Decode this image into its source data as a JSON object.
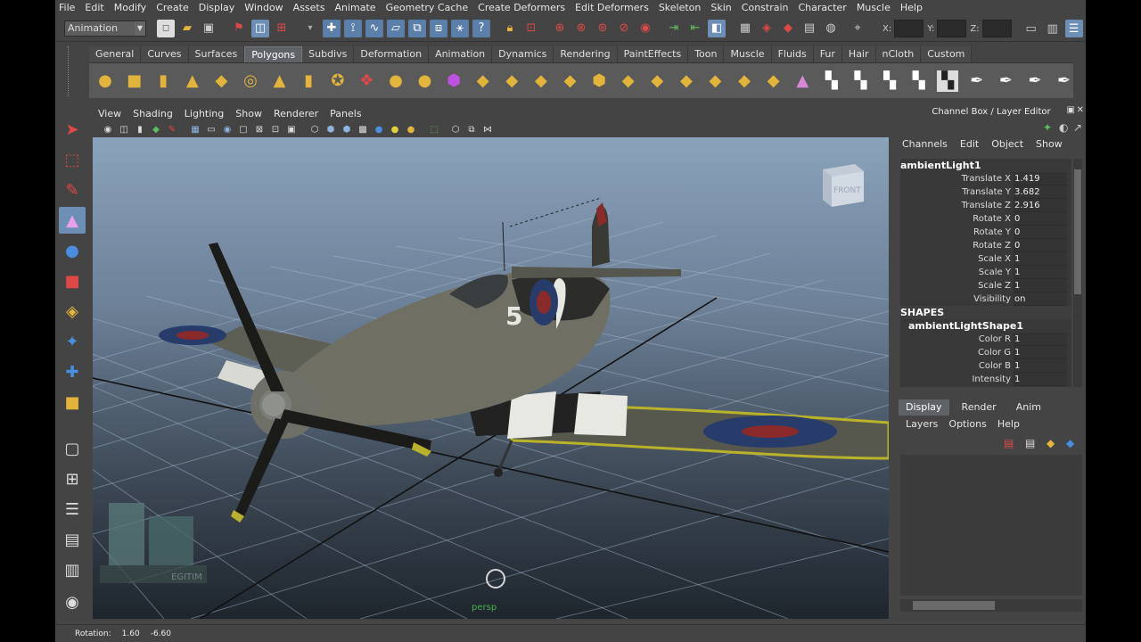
{
  "menubar": [
    "File",
    "Edit",
    "Modify",
    "Create",
    "Display",
    "Window",
    "Assets",
    "Animate",
    "Geometry Cache",
    "Create Deformers",
    "Edit Deformers",
    "Skeleton",
    "Skin",
    "Constrain",
    "Character",
    "Muscle",
    "Help"
  ],
  "statusline": {
    "mode": "Animation",
    "x_label": "X:",
    "y_label": "Y:",
    "z_label": "Z:"
  },
  "shelf": {
    "tabs": [
      "General",
      "Curves",
      "Surfaces",
      "Polygons",
      "Subdivs",
      "Deformation",
      "Animation",
      "Dynamics",
      "Rendering",
      "PaintEffects",
      "Toon",
      "Muscle",
      "Fluids",
      "Fur",
      "Hair",
      "nCloth",
      "Custom"
    ],
    "active_tab": "Polygons"
  },
  "panel": {
    "menus": [
      "View",
      "Shading",
      "Lighting",
      "Show",
      "Renderer",
      "Panels"
    ],
    "camera": "persp",
    "viewcube_label": "FRONT"
  },
  "channel_box": {
    "title": "Channel Box / Layer Editor",
    "menus": [
      "Channels",
      "Edit",
      "Object",
      "Show"
    ],
    "node": "ambientLight1",
    "attributes": [
      {
        "name": "Translate X",
        "value": "1.419"
      },
      {
        "name": "Translate Y",
        "value": "3.682"
      },
      {
        "name": "Translate Z",
        "value": "2.916"
      },
      {
        "name": "Rotate X",
        "value": "0"
      },
      {
        "name": "Rotate Y",
        "value": "0"
      },
      {
        "name": "Rotate Z",
        "value": "0"
      },
      {
        "name": "Scale X",
        "value": "1"
      },
      {
        "name": "Scale Y",
        "value": "1"
      },
      {
        "name": "Scale Z",
        "value": "1"
      },
      {
        "name": "Visibility",
        "value": "on"
      }
    ],
    "shapes_header": "SHAPES",
    "shape_node": "ambientLightShape1",
    "shape_attributes": [
      {
        "name": "Color R",
        "value": "1"
      },
      {
        "name": "Color G",
        "value": "1"
      },
      {
        "name": "Color B",
        "value": "1"
      },
      {
        "name": "Intensity",
        "value": "1"
      }
    ]
  },
  "layer_editor": {
    "tabs": [
      "Display",
      "Render",
      "Anim"
    ],
    "active_tab": "Display",
    "menus": [
      "Layers",
      "Options",
      "Help"
    ]
  },
  "helpline": {
    "label": "Rotation:",
    "v1": "1.60",
    "v2": "-6.60"
  },
  "colors": {
    "accent": "#6e8fb5",
    "camera_label": "#4caf50",
    "ui_bg": "#444444"
  }
}
